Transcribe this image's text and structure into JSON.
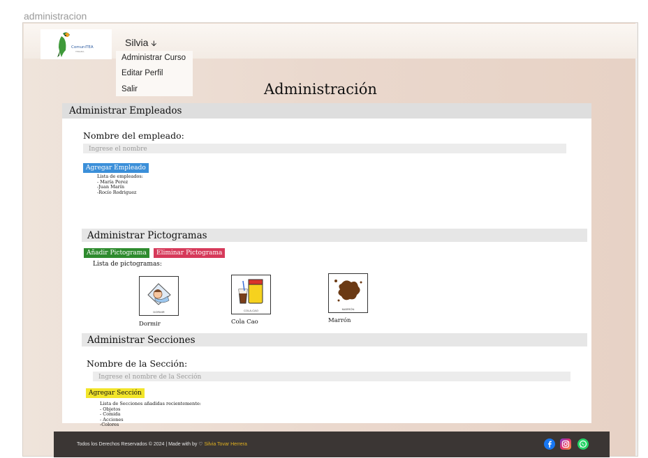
{
  "window": {
    "title": "administracion"
  },
  "header": {
    "logo_text": "ComuniTEA",
    "user_name": "Silvia",
    "menu": [
      "Administrar Curso",
      "Editar Perfil",
      "Salir"
    ]
  },
  "page": {
    "title": "Administración"
  },
  "employees": {
    "section_title": "Administrar Empleados",
    "field_label": "Nombre del empleado:",
    "input_placeholder": "Ingrese el nombre",
    "add_button": "Agregar Empleado",
    "list_title": "Lista de empleados:",
    "list": [
      "- María Perez",
      "-Juan Marín",
      "-Rocío Rodriguez"
    ]
  },
  "pictograms": {
    "section_title": "Administrar Pictogramas",
    "add_button": "Añadir Pictograma",
    "delete_button": "Eliminar Pictograma",
    "list_title": "Lista de pictogramas:",
    "items": [
      {
        "caption": "DORMIR",
        "label": "Dormir"
      },
      {
        "caption": "COLA-CAO",
        "label": "Cola Cao"
      },
      {
        "caption": "MARRÓN",
        "label": "Marrón"
      }
    ]
  },
  "sections": {
    "section_title": "Administrar Secciones",
    "field_label": "Nombre de la Sección:",
    "input_placeholder": "Ingrese el nombre de la Sección",
    "add_button": "Agregar Sección",
    "list_title": "Lista de Secciones añadidas recientemente:",
    "list": [
      "- Objetos",
      "- Comida",
      "- Acciones",
      "-Colores"
    ]
  },
  "footer": {
    "text": "Todos los Derechos Reservados © 2024 | Made with by ♡ ",
    "author": "Silvia Tovar Herrera"
  },
  "colors": {
    "add_employee_btn": "#3b8fd9",
    "add_picto_btn": "#2e8b2e",
    "delete_picto_btn": "#d63a5a",
    "add_section_btn": "#f2e52a",
    "footer_bg": "#3b3634",
    "author": "#e0b020"
  },
  "icons": [
    "parrot-logo",
    "chevron-down-icon",
    "facebook-icon",
    "instagram-icon",
    "whatsapp-icon"
  ]
}
